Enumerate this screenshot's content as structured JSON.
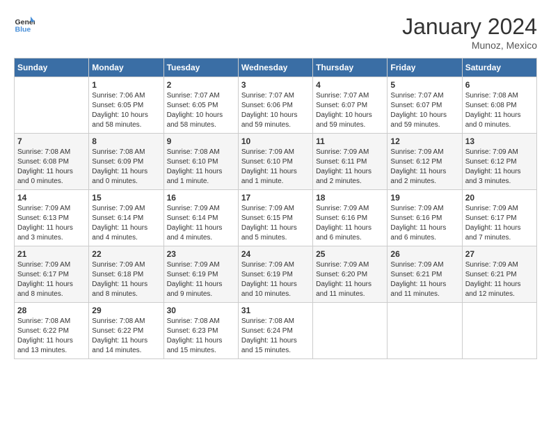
{
  "header": {
    "logo_general": "General",
    "logo_blue": "Blue",
    "month_title": "January 2024",
    "location": "Munoz, Mexico"
  },
  "columns": [
    "Sunday",
    "Monday",
    "Tuesday",
    "Wednesday",
    "Thursday",
    "Friday",
    "Saturday"
  ],
  "weeks": [
    [
      {
        "day": "",
        "info": ""
      },
      {
        "day": "1",
        "info": "Sunrise: 7:06 AM\nSunset: 6:05 PM\nDaylight: 10 hours\nand 58 minutes."
      },
      {
        "day": "2",
        "info": "Sunrise: 7:07 AM\nSunset: 6:05 PM\nDaylight: 10 hours\nand 58 minutes."
      },
      {
        "day": "3",
        "info": "Sunrise: 7:07 AM\nSunset: 6:06 PM\nDaylight: 10 hours\nand 59 minutes."
      },
      {
        "day": "4",
        "info": "Sunrise: 7:07 AM\nSunset: 6:07 PM\nDaylight: 10 hours\nand 59 minutes."
      },
      {
        "day": "5",
        "info": "Sunrise: 7:07 AM\nSunset: 6:07 PM\nDaylight: 10 hours\nand 59 minutes."
      },
      {
        "day": "6",
        "info": "Sunrise: 7:08 AM\nSunset: 6:08 PM\nDaylight: 11 hours\nand 0 minutes."
      }
    ],
    [
      {
        "day": "7",
        "info": "Sunrise: 7:08 AM\nSunset: 6:08 PM\nDaylight: 11 hours\nand 0 minutes."
      },
      {
        "day": "8",
        "info": "Sunrise: 7:08 AM\nSunset: 6:09 PM\nDaylight: 11 hours\nand 0 minutes."
      },
      {
        "day": "9",
        "info": "Sunrise: 7:08 AM\nSunset: 6:10 PM\nDaylight: 11 hours\nand 1 minute."
      },
      {
        "day": "10",
        "info": "Sunrise: 7:09 AM\nSunset: 6:10 PM\nDaylight: 11 hours\nand 1 minute."
      },
      {
        "day": "11",
        "info": "Sunrise: 7:09 AM\nSunset: 6:11 PM\nDaylight: 11 hours\nand 2 minutes."
      },
      {
        "day": "12",
        "info": "Sunrise: 7:09 AM\nSunset: 6:12 PM\nDaylight: 11 hours\nand 2 minutes."
      },
      {
        "day": "13",
        "info": "Sunrise: 7:09 AM\nSunset: 6:12 PM\nDaylight: 11 hours\nand 3 minutes."
      }
    ],
    [
      {
        "day": "14",
        "info": "Sunrise: 7:09 AM\nSunset: 6:13 PM\nDaylight: 11 hours\nand 3 minutes."
      },
      {
        "day": "15",
        "info": "Sunrise: 7:09 AM\nSunset: 6:14 PM\nDaylight: 11 hours\nand 4 minutes."
      },
      {
        "day": "16",
        "info": "Sunrise: 7:09 AM\nSunset: 6:14 PM\nDaylight: 11 hours\nand 4 minutes."
      },
      {
        "day": "17",
        "info": "Sunrise: 7:09 AM\nSunset: 6:15 PM\nDaylight: 11 hours\nand 5 minutes."
      },
      {
        "day": "18",
        "info": "Sunrise: 7:09 AM\nSunset: 6:16 PM\nDaylight: 11 hours\nand 6 minutes."
      },
      {
        "day": "19",
        "info": "Sunrise: 7:09 AM\nSunset: 6:16 PM\nDaylight: 11 hours\nand 6 minutes."
      },
      {
        "day": "20",
        "info": "Sunrise: 7:09 AM\nSunset: 6:17 PM\nDaylight: 11 hours\nand 7 minutes."
      }
    ],
    [
      {
        "day": "21",
        "info": "Sunrise: 7:09 AM\nSunset: 6:17 PM\nDaylight: 11 hours\nand 8 minutes."
      },
      {
        "day": "22",
        "info": "Sunrise: 7:09 AM\nSunset: 6:18 PM\nDaylight: 11 hours\nand 8 minutes."
      },
      {
        "day": "23",
        "info": "Sunrise: 7:09 AM\nSunset: 6:19 PM\nDaylight: 11 hours\nand 9 minutes."
      },
      {
        "day": "24",
        "info": "Sunrise: 7:09 AM\nSunset: 6:19 PM\nDaylight: 11 hours\nand 10 minutes."
      },
      {
        "day": "25",
        "info": "Sunrise: 7:09 AM\nSunset: 6:20 PM\nDaylight: 11 hours\nand 11 minutes."
      },
      {
        "day": "26",
        "info": "Sunrise: 7:09 AM\nSunset: 6:21 PM\nDaylight: 11 hours\nand 11 minutes."
      },
      {
        "day": "27",
        "info": "Sunrise: 7:09 AM\nSunset: 6:21 PM\nDaylight: 11 hours\nand 12 minutes."
      }
    ],
    [
      {
        "day": "28",
        "info": "Sunrise: 7:08 AM\nSunset: 6:22 PM\nDaylight: 11 hours\nand 13 minutes."
      },
      {
        "day": "29",
        "info": "Sunrise: 7:08 AM\nSunset: 6:22 PM\nDaylight: 11 hours\nand 14 minutes."
      },
      {
        "day": "30",
        "info": "Sunrise: 7:08 AM\nSunset: 6:23 PM\nDaylight: 11 hours\nand 15 minutes."
      },
      {
        "day": "31",
        "info": "Sunrise: 7:08 AM\nSunset: 6:24 PM\nDaylight: 11 hours\nand 15 minutes."
      },
      {
        "day": "",
        "info": ""
      },
      {
        "day": "",
        "info": ""
      },
      {
        "day": "",
        "info": ""
      }
    ]
  ]
}
